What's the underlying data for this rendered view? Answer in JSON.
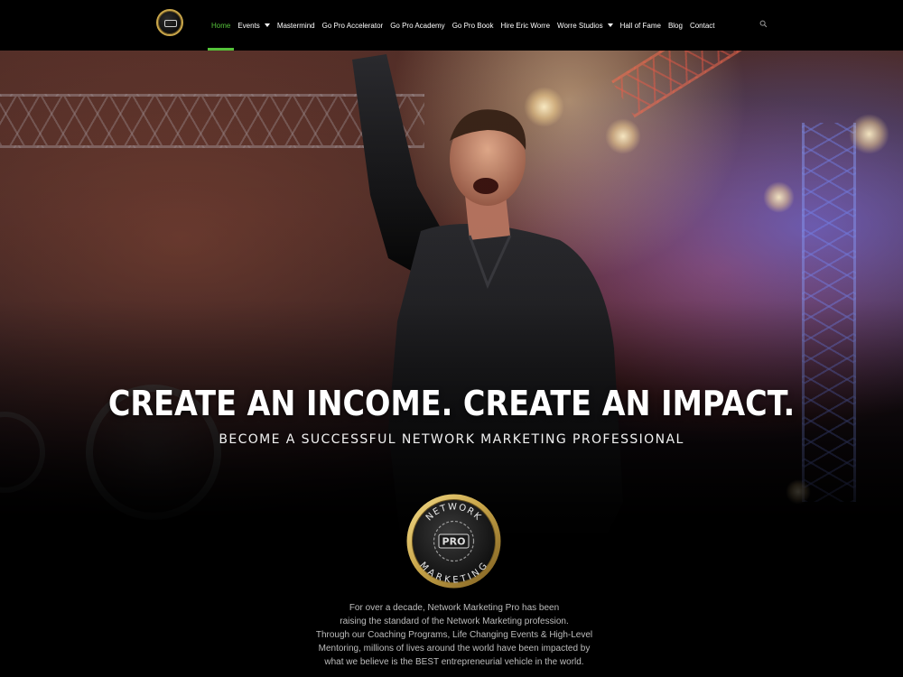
{
  "nav": {
    "logo_name": "network-marketing-pro-logo",
    "items": [
      {
        "label": "Home",
        "active": true,
        "dropdown": false
      },
      {
        "label": "Events",
        "active": false,
        "dropdown": true
      },
      {
        "label": "Mastermind",
        "active": false,
        "dropdown": false
      },
      {
        "label": "Go Pro Accelerator",
        "active": false,
        "dropdown": false
      },
      {
        "label": "Go Pro Academy",
        "active": false,
        "dropdown": false
      },
      {
        "label": "Go Pro Book",
        "active": false,
        "dropdown": false
      },
      {
        "label": "Hire Eric Worre",
        "active": false,
        "dropdown": false
      },
      {
        "label": "Worre Studios",
        "active": false,
        "dropdown": true
      },
      {
        "label": "Hall of Fame",
        "active": false,
        "dropdown": false
      },
      {
        "label": "Blog",
        "active": false,
        "dropdown": false
      },
      {
        "label": "Contact",
        "active": false,
        "dropdown": false
      }
    ],
    "search_icon": "search-icon"
  },
  "hero": {
    "headline": "CREATE AN INCOME. CREATE AN IMPACT.",
    "subheadline": "BECOME A SUCCESSFUL NETWORK MARKETING PROFESSIONAL",
    "badge": {
      "top": "NETWORK",
      "center": "PRO",
      "bottom": "MARKETING"
    },
    "about_text": "For over a decade, Network Marketing Pro has been\nraising the standard of the Network Marketing profession.\nThrough our Coaching Programs, Life Changing Events & High-Level\nMentoring, millions of lives around the world have been impacted by\nwhat we believe is the BEST entrepreneurial vehicle in the world."
  },
  "colors": {
    "accent": "#55c23a",
    "gold": "#c9a64a",
    "background": "#000000"
  }
}
